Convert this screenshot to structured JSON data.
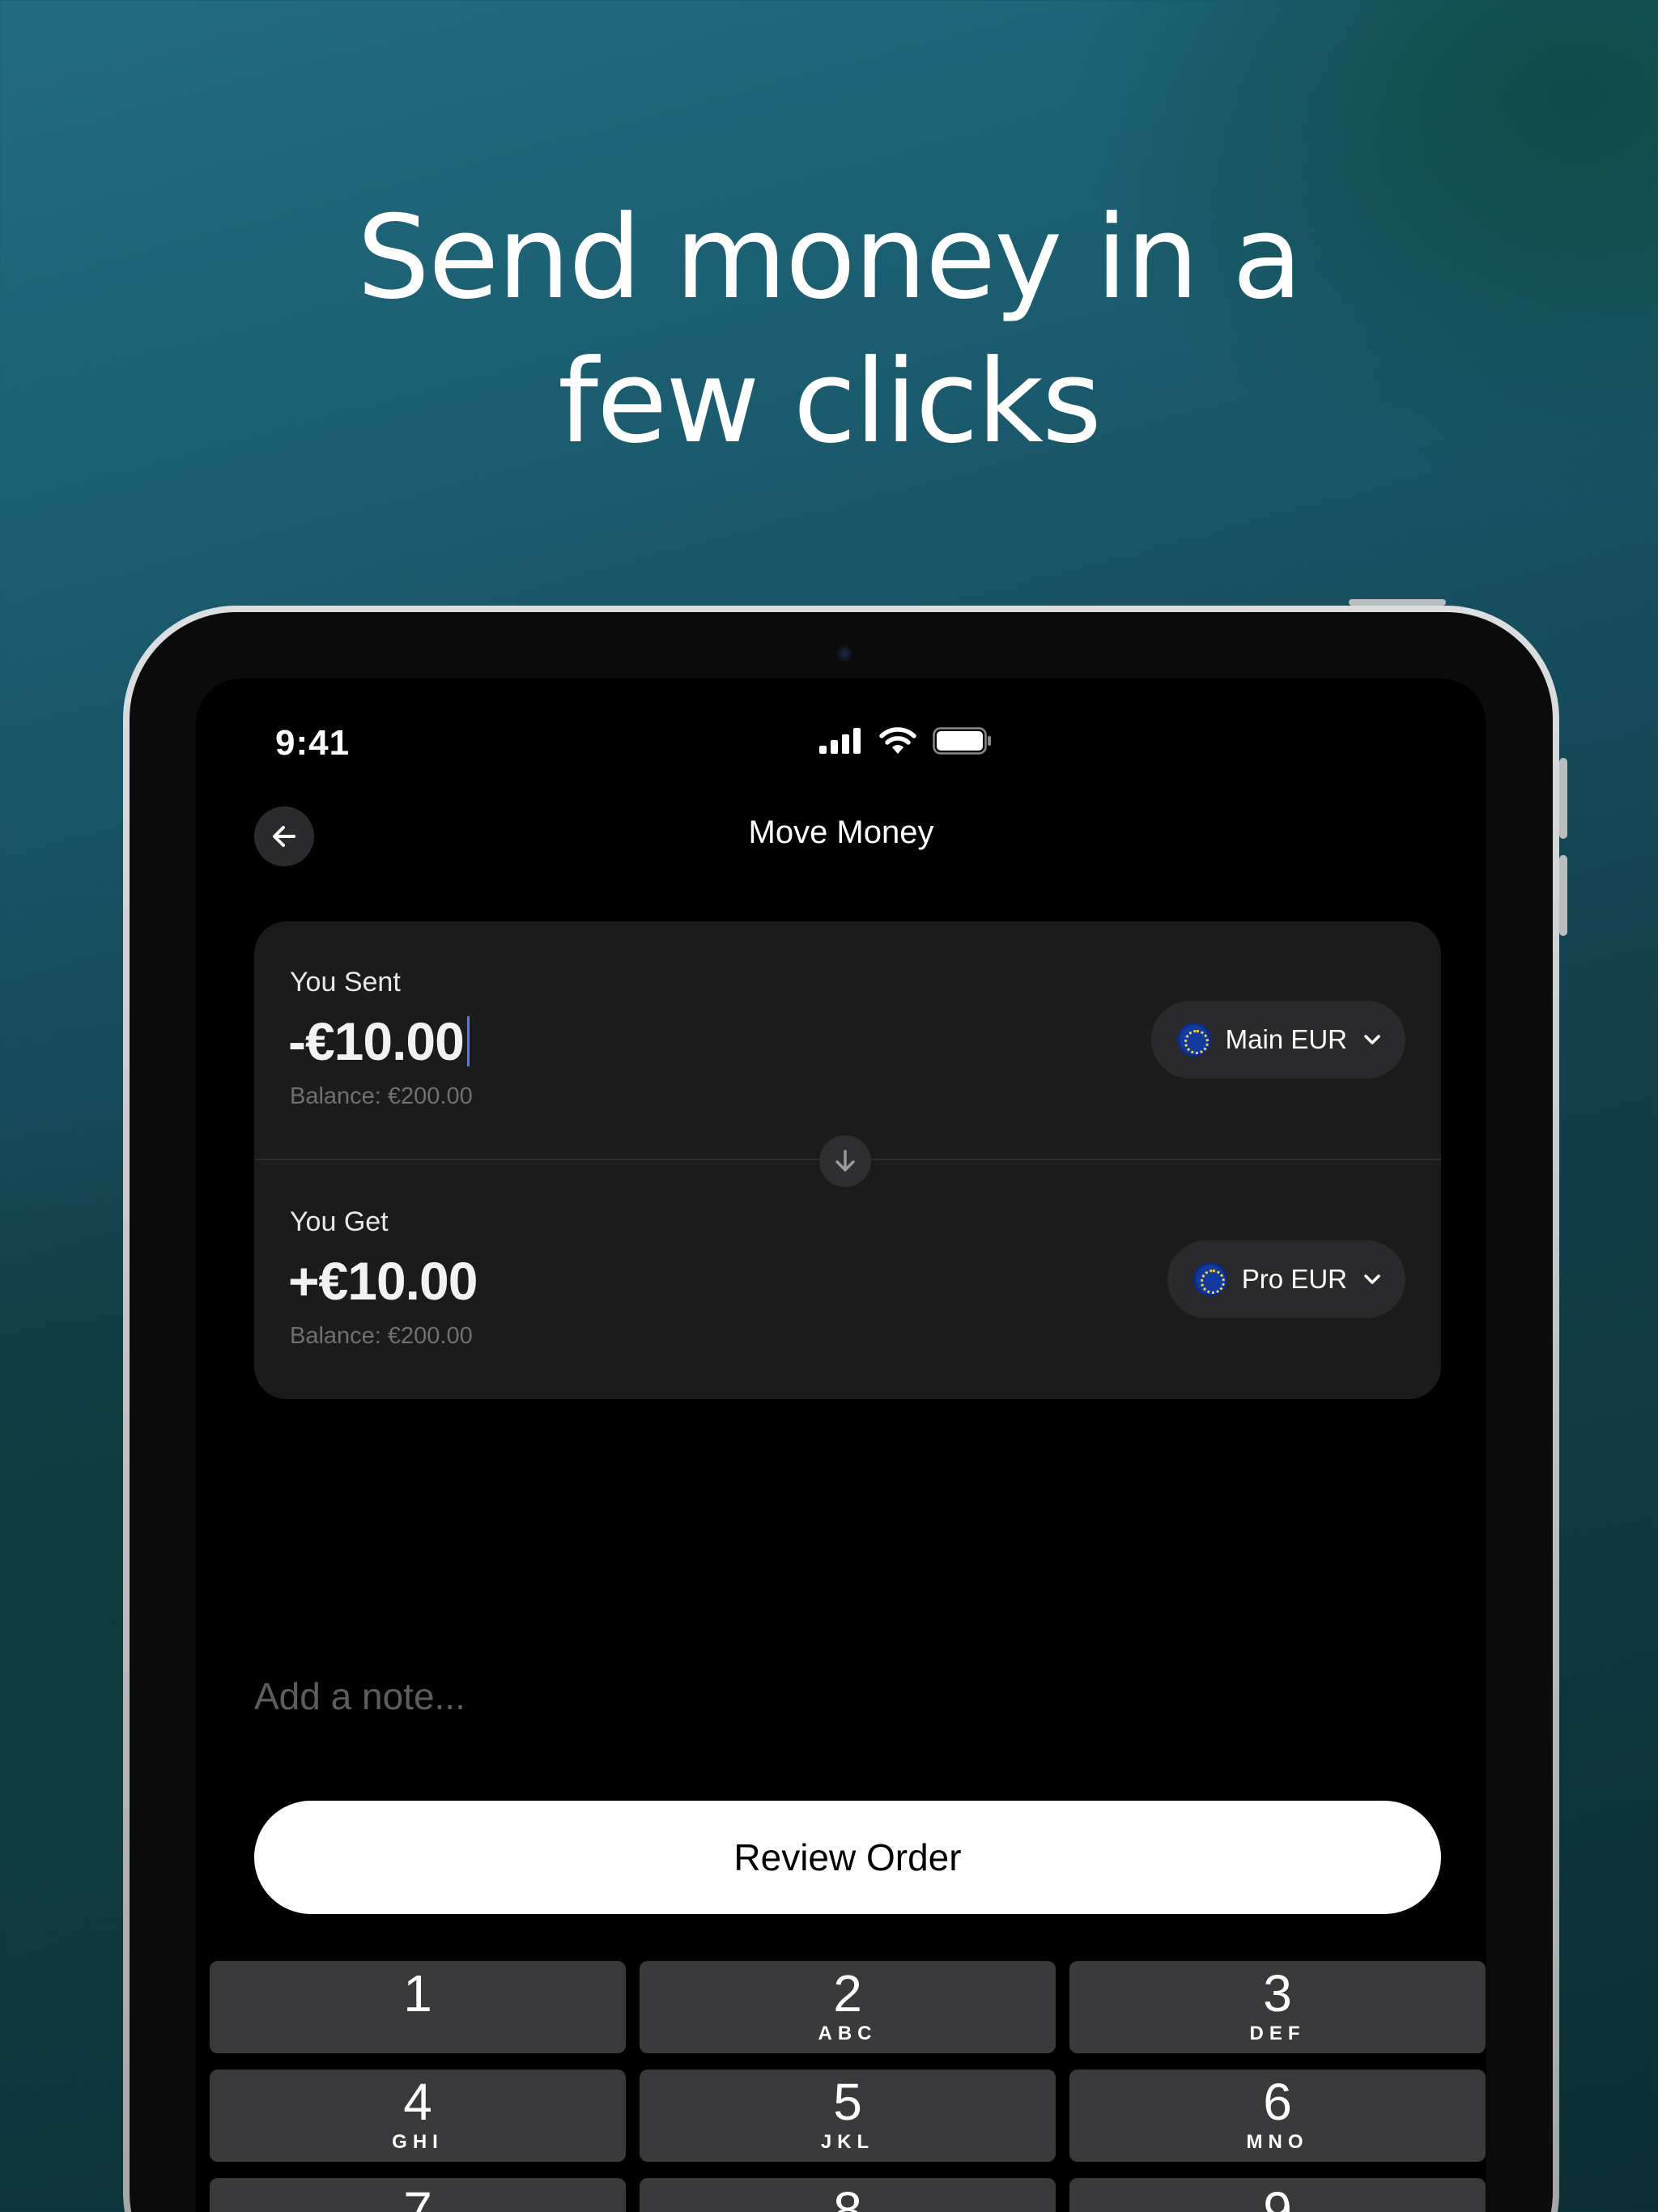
{
  "headline": {
    "line1": "Send money in a",
    "line2": "few clicks"
  },
  "status_bar": {
    "time": "9:41"
  },
  "header": {
    "title": "Move Money"
  },
  "send": {
    "label": "You Sent",
    "amount": "-€10.00",
    "balance": "Balance: €200.00",
    "account": "Main EUR"
  },
  "receive": {
    "label": "You Get",
    "amount": "+€10.00",
    "balance": "Balance: €200.00",
    "account": "Pro EUR"
  },
  "note": {
    "placeholder": "Add a note..."
  },
  "review_button": {
    "label": "Review Order"
  },
  "keypad": [
    {
      "num": "1",
      "letters": ""
    },
    {
      "num": "2",
      "letters": "ABC"
    },
    {
      "num": "3",
      "letters": "DEF"
    },
    {
      "num": "4",
      "letters": "GHI"
    },
    {
      "num": "5",
      "letters": "JKL"
    },
    {
      "num": "6",
      "letters": "MNO"
    },
    {
      "num": "7",
      "letters": ""
    },
    {
      "num": "8",
      "letters": ""
    },
    {
      "num": "9",
      "letters": ""
    }
  ],
  "colors": {
    "accent_caret": "#4f7cff",
    "card": "#1b1b1c",
    "key": "#3a3a3c"
  }
}
